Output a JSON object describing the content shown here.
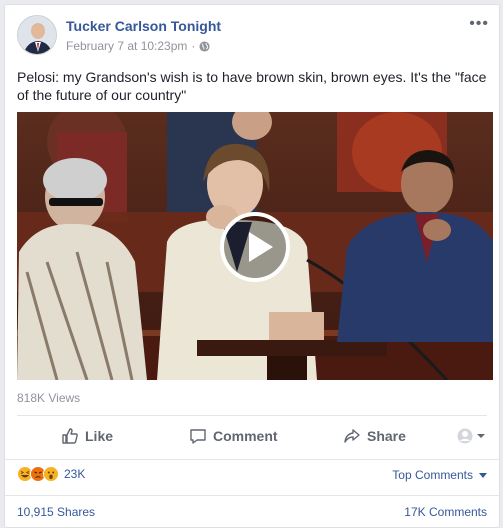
{
  "post": {
    "page_name": "Tucker Carlson Tonight",
    "timestamp": "February 7 at 10:23pm",
    "separator": "·",
    "audience_icon": "globe-icon",
    "more_icon": "more-options-icon",
    "more_label": "•••",
    "text": "Pelosi: my Grandson's wish is to have brown skin, brown eyes. It's the \"face of the future of our country\""
  },
  "video": {
    "play_icon": "play-icon",
    "views": "818K Views"
  },
  "actions": {
    "like": "Like",
    "comment": "Comment",
    "share": "Share"
  },
  "stats": {
    "reaction_icons": [
      "haha-icon",
      "angry-icon",
      "wow-icon"
    ],
    "reaction_count": "23K",
    "top_comments": "Top Comments",
    "shares": "10,915 Shares",
    "comments": "17K Comments"
  },
  "colors": {
    "link": "#365899",
    "muted": "#90949c",
    "action": "#606770",
    "reaction_yellow": "#f7b125",
    "reaction_red": "#e9710f"
  }
}
